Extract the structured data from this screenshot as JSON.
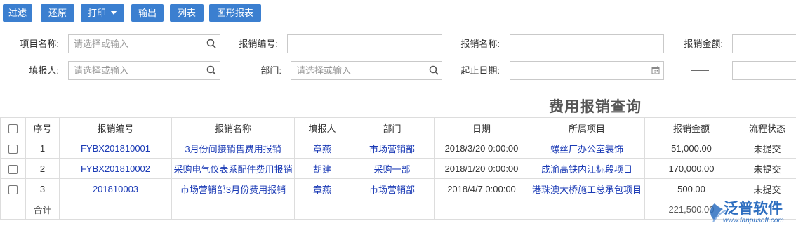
{
  "toolbar": {
    "filter_label": "过滤",
    "reset_label": "还原",
    "print_label": "打印",
    "export_label": "输出",
    "list_label": "列表",
    "chart_report_label": "图形报表"
  },
  "filters": {
    "project_name_label": "项目名称:",
    "project_name_placeholder": "请选择或输入",
    "expense_no_label": "报销编号:",
    "expense_name_label": "报销名称:",
    "expense_amount_label": "报销金额:",
    "applicant_label": "填报人:",
    "applicant_placeholder": "请选择或输入",
    "department_label": "部门:",
    "department_placeholder": "请选择或输入",
    "date_range_label": "起止日期:",
    "range_separator": "——"
  },
  "report_title": "费用报销查询",
  "table": {
    "headers": [
      "序号",
      "报销编号",
      "报销名称",
      "填报人",
      "部门",
      "日期",
      "所属项目",
      "报销金额",
      "流程状态"
    ],
    "rows": [
      {
        "seq": "1",
        "no": "FYBX201810001",
        "name": "3月份间接销售费用报销",
        "applicant": "章燕",
        "dept": "市场营销部",
        "date": "2018/3/20 0:00:00",
        "project": "螺丝厂办公室装饰",
        "amount": "51,000.00",
        "status": "未提交"
      },
      {
        "seq": "2",
        "no": "FYBX201810002",
        "name": "采购电气仪表系配件费用报销",
        "applicant": "胡建",
        "dept": "采购一部",
        "date": "2018/1/20 0:00:00",
        "project": "成渝高铁内江标段项目",
        "amount": "170,000.00",
        "status": "未提交"
      },
      {
        "seq": "3",
        "no": "201810003",
        "name": "市场营销部3月份费用报销",
        "applicant": "章燕",
        "dept": "市场营销部",
        "date": "2018/4/7 0:00:00",
        "project": "港珠澳大桥施工总承包项目",
        "amount": "500.00",
        "status": "未提交"
      }
    ],
    "total_label": "合计",
    "total_amount": "221,500.00"
  },
  "watermark": {
    "brand": "泛普软件",
    "url": "www.fanpusoft.com"
  },
  "colors": {
    "toolbar_button": "#3b7fd0",
    "link_text": "#1a3ab5",
    "border": "#dddddd"
  },
  "icons": {
    "search": "search-icon",
    "calendar": "calendar-icon",
    "dropdown": "caret-down-icon"
  }
}
